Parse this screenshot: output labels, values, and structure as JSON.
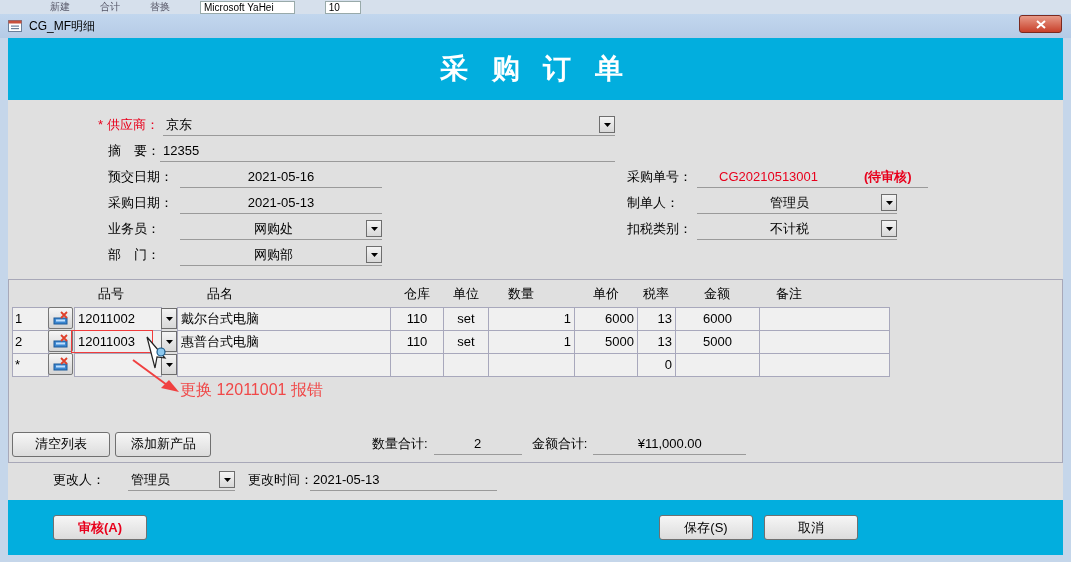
{
  "background_toolbar": [
    {
      "kind": "button",
      "label": "新建"
    },
    {
      "kind": "button",
      "label": "合计"
    },
    {
      "kind": "button",
      "label": "替换"
    },
    {
      "kind": "dropdown",
      "value": "Microsoft YaHei"
    },
    {
      "kind": "dropdown",
      "value": "10"
    }
  ],
  "window": {
    "title": "CG_MF明细"
  },
  "header": {
    "title": "采 购 订 单"
  },
  "form_rows": [
    {
      "left": {
        "label": "* 供应商：",
        "value": "京东",
        "kind": "wide_dropdown",
        "required": true
      }
    },
    {
      "left": {
        "label": "摘　要：",
        "value": "12355",
        "kind": "wide_text",
        "required": false
      }
    },
    {
      "left": {
        "label": "预交日期：",
        "value": "2021-05-16",
        "kind": "text",
        "required": false
      },
      "right": {
        "label": "采购单号：",
        "value": "CG20210513001",
        "status": "(待审核)",
        "kind": "order_number"
      }
    },
    {
      "left": {
        "label": "采购日期：",
        "value": "2021-05-13",
        "kind": "text",
        "required": false
      },
      "right": {
        "label": "制单人：",
        "value": "管理员",
        "kind": "dropdown"
      }
    },
    {
      "left": {
        "label": "业务员：",
        "value": "网购处",
        "kind": "dropdown",
        "required": false
      },
      "right": {
        "label": "扣税类别：",
        "value": "不计税",
        "kind": "dropdown"
      }
    },
    {
      "left": {
        "label": "部　门：",
        "value": "网购部",
        "kind": "dropdown",
        "required": false
      }
    }
  ],
  "table": {
    "columns": [
      "品号",
      "品名",
      "仓库",
      "单位",
      "数量",
      "单价",
      "税率",
      "金额",
      "备注"
    ],
    "rows": [
      {
        "selector": "1",
        "flagged": false,
        "cells": [
          "12011002",
          "戴尔台式电脑",
          "110",
          "set",
          "1",
          "6000",
          "13",
          "6000",
          null
        ]
      },
      {
        "selector": "2",
        "flagged": true,
        "cells": [
          "12011003",
          "惠普台式电脑",
          "110",
          "set",
          "1",
          "5000",
          "13",
          "5000",
          null
        ]
      },
      {
        "selector": "*",
        "flagged": false,
        "cells": [
          null,
          null,
          null,
          null,
          null,
          null,
          "0",
          null,
          null
        ]
      }
    ]
  },
  "annotation": {
    "text": "更换 12011001 报错"
  },
  "table_buttons": [
    "清空列表",
    "添加新产品"
  ],
  "totals": [
    {
      "label": "数量合计:",
      "value": "2"
    },
    {
      "label": "金额合计:",
      "value": "¥11,000.00"
    }
  ],
  "modified": {
    "by_label": "更改人：",
    "by": "管理员",
    "time_label": "更改时间：",
    "time": "2021-05-13"
  },
  "left_actions": [
    {
      "label": "审核(A)",
      "emphasis": true
    }
  ],
  "right_actions": [
    {
      "label": "保存(S)",
      "emphasis": false
    },
    {
      "label": "取消",
      "emphasis": false
    }
  ]
}
